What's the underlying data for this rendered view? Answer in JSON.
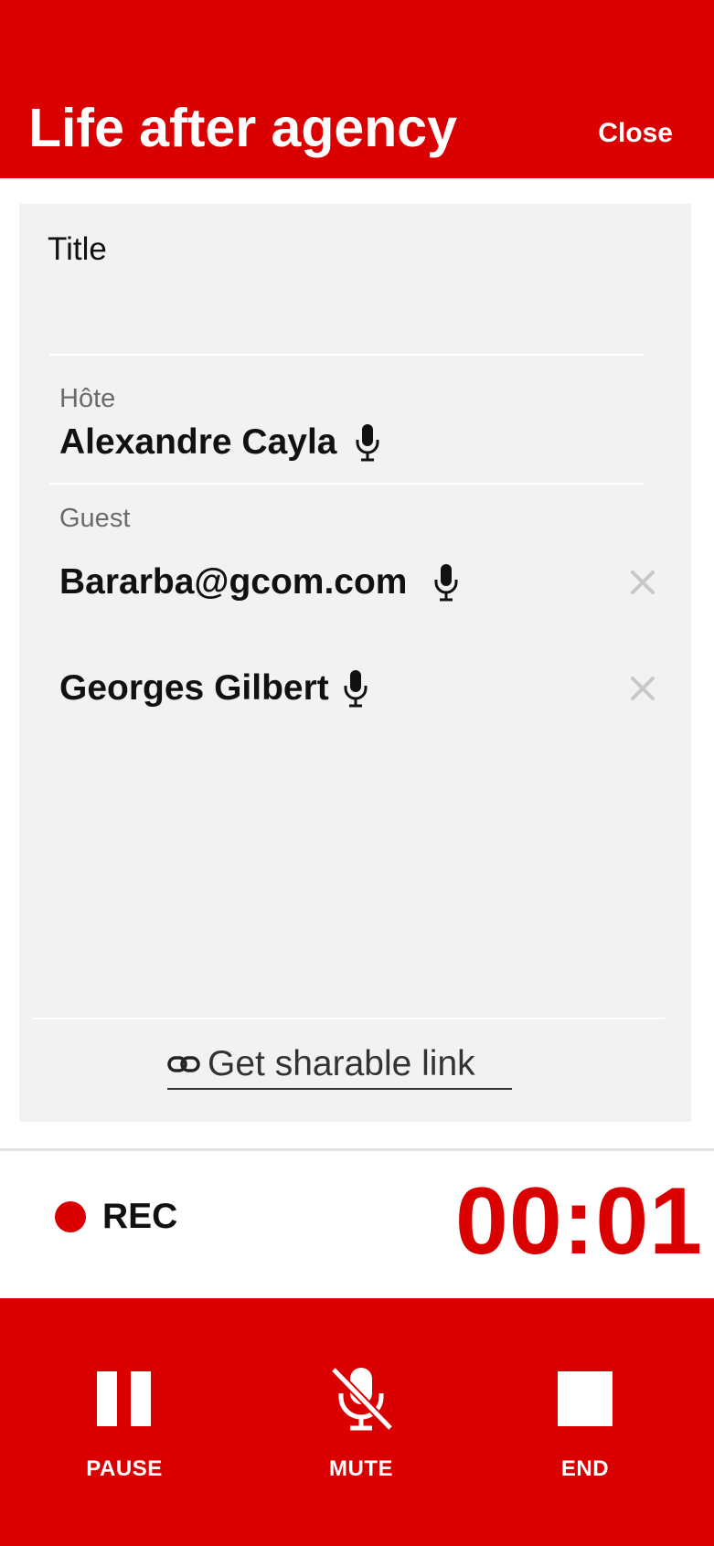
{
  "header": {
    "title": "Life after agency",
    "close_label": "Close"
  },
  "form": {
    "title_label": "Title",
    "title_value": "",
    "host_label": "Hôte",
    "host_name": "Alexandre Cayla",
    "guest_label": "Guest",
    "guests": [
      {
        "name": "Bararba@gcom.com"
      },
      {
        "name": "Georges Gilbert"
      }
    ],
    "share_link_label": "Get sharable link"
  },
  "recording": {
    "status_label": "REC",
    "timer": "00:01"
  },
  "controls": {
    "pause_label": "PAUSE",
    "mute_label": "MUTE",
    "end_label": "END"
  },
  "colors": {
    "accent": "#da0000",
    "card_bg": "#f2f2f2",
    "icon_gray": "#c8c8c8"
  }
}
